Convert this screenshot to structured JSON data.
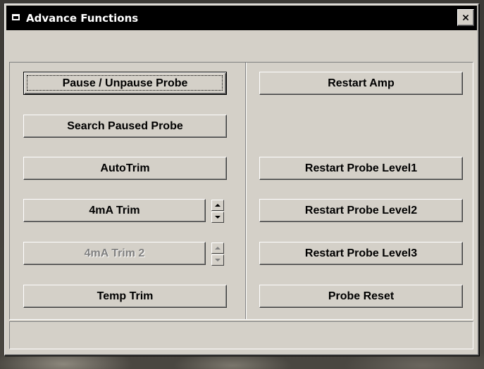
{
  "window": {
    "title": "Advance Functions",
    "close_icon": "close-icon",
    "system_icon": "window-icon"
  },
  "left_column": {
    "pause_unpause_label": "Pause / Unpause Probe",
    "search_paused_label": "Search Paused Probe",
    "autotrim_label": "AutoTrim",
    "trim_4ma_label": "4mA Trim",
    "trim_4ma_2_label": "4mA Trim 2",
    "temp_trim_label": "Temp Trim"
  },
  "right_column": {
    "restart_amp_label": "Restart Amp",
    "restart_level1_label": "Restart Probe Level1",
    "restart_level2_label": "Restart Probe Level2",
    "restart_level3_label": "Restart Probe Level3",
    "probe_reset_label": "Probe Reset"
  },
  "states": {
    "default_button": "Pause / Unpause Probe",
    "disabled_controls": [
      "4mA Trim 2"
    ]
  },
  "colors": {
    "title_bar": "#000000",
    "face": "#d4d0c8",
    "disabled_text": "#808080"
  }
}
